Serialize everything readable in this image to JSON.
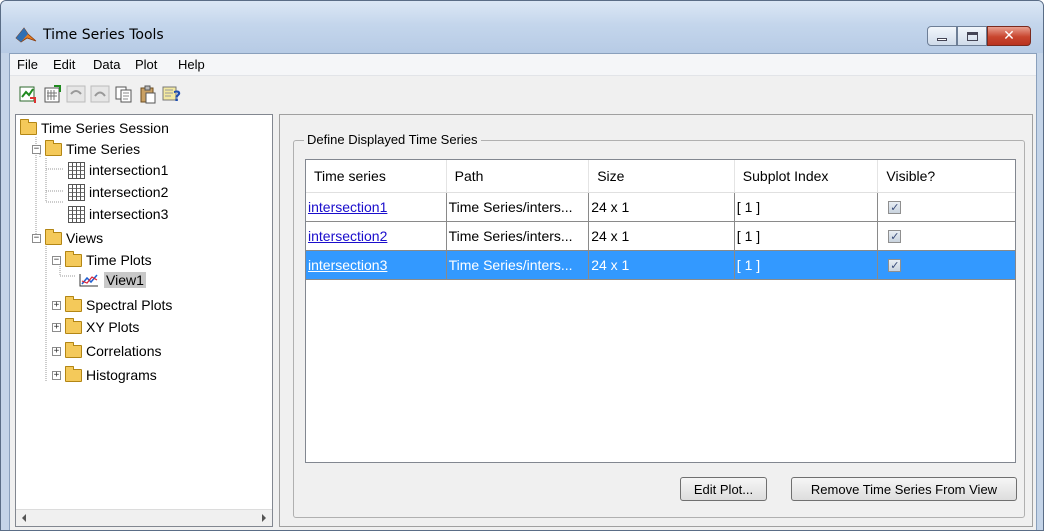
{
  "window": {
    "title": "Time Series Tools"
  },
  "menu": {
    "items": [
      "File",
      "Edit",
      "Data",
      "Plot",
      "Help"
    ]
  },
  "toolbar": {
    "buttons": [
      "import-data-icon",
      "new-series-icon",
      "undo-icon",
      "redo-icon",
      "copy-icon",
      "paste-icon",
      "help-icon"
    ]
  },
  "tree": {
    "root": "Time Series Session",
    "time_series": "Time Series",
    "series": [
      "intersection1",
      "intersection2",
      "intersection3"
    ],
    "views": "Views",
    "time_plots": "Time Plots",
    "view1": "View1",
    "spectral_plots": "Spectral Plots",
    "xy_plots": "XY Plots",
    "correlations": "Correlations",
    "histograms": "Histograms"
  },
  "group": {
    "title": "Define Displayed Time Series"
  },
  "table": {
    "columns": [
      "Time series",
      "Path",
      "Size",
      "Subplot Index",
      "Visible?"
    ],
    "rows": [
      {
        "name": "intersection1",
        "path": "Time Series/inters...",
        "size": "24 x 1",
        "subplot": "[ 1 ]",
        "visible": true
      },
      {
        "name": "intersection2",
        "path": "Time Series/inters...",
        "size": "24 x 1",
        "subplot": "[ 1 ]",
        "visible": true
      },
      {
        "name": "intersection3",
        "path": "Time Series/inters...",
        "size": "24 x 1",
        "subplot": "[ 1 ]",
        "visible": true
      }
    ],
    "selected_row": 3
  },
  "buttons": {
    "edit_plot": "Edit Plot...",
    "remove": "Remove Time Series From View"
  }
}
